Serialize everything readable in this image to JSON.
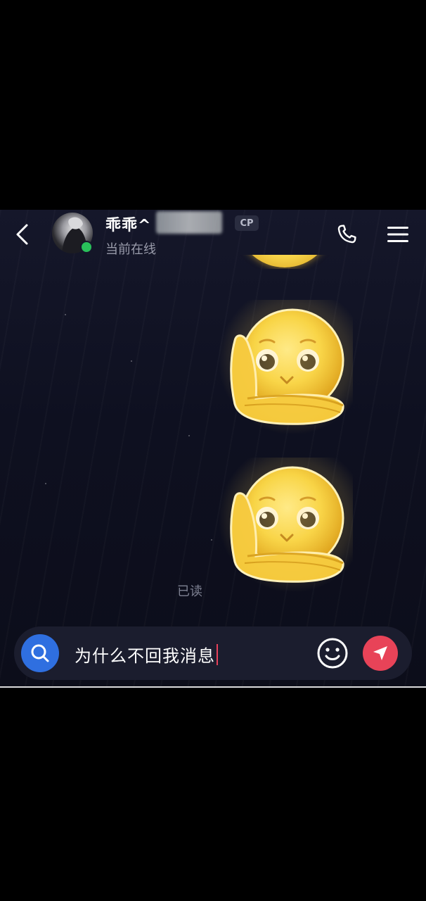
{
  "header": {
    "contact_name": "乖乖^",
    "status": "当前在线",
    "cp_badge": "CP"
  },
  "messages": [
    {
      "type": "sticker",
      "sender": "me",
      "icon": "peeking-face-sticker"
    },
    {
      "type": "sticker",
      "sender": "me",
      "icon": "peeking-face-sticker"
    }
  ],
  "read_status": "已读",
  "composer": {
    "input_value": "为什么不回我消息"
  },
  "colors": {
    "online": "#29c05a",
    "search_button": "#2f6fe0",
    "send_button": "#e84358",
    "sticker_yellow": "#f8d54a"
  }
}
